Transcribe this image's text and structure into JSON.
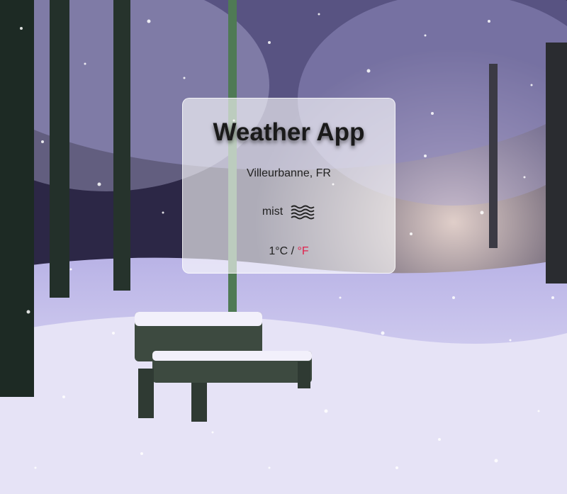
{
  "app": {
    "title": "Weather App"
  },
  "location": "Villeurbanne, FR",
  "weather": {
    "condition": "mist",
    "icon": "mist-icon"
  },
  "temperature": {
    "value": "1",
    "unit_celsius": "°C",
    "separator": " / ",
    "unit_fahrenheit_link": "°F"
  },
  "colors": {
    "link_accent": "#e0234e",
    "card_background": "rgba(255,255,255,0.62)"
  }
}
